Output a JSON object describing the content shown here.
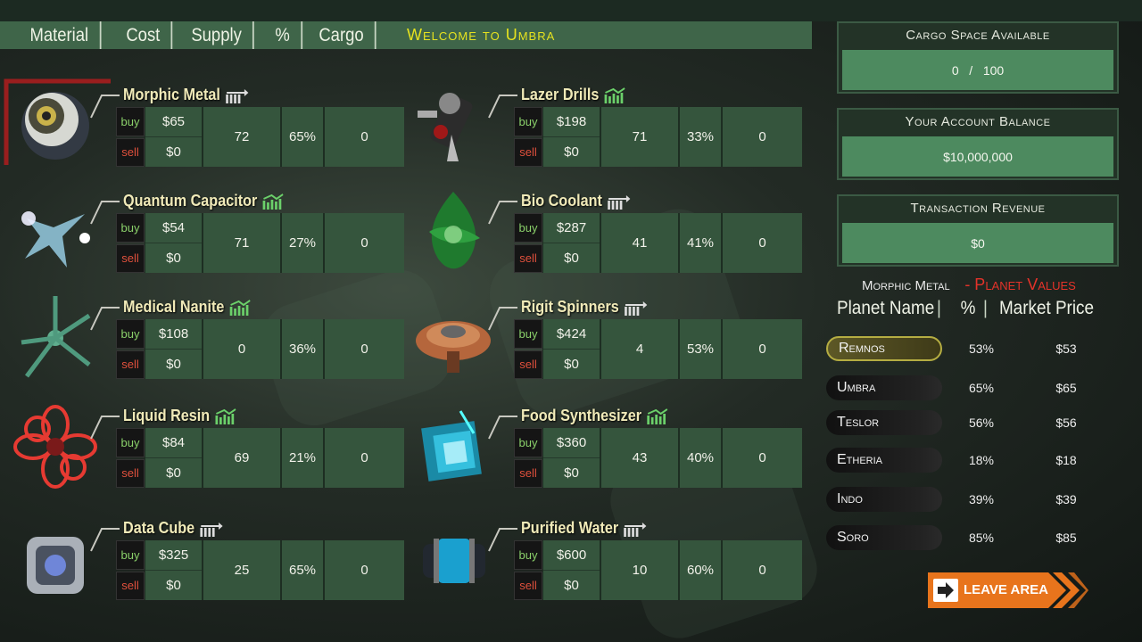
{
  "header": {
    "columns": [
      "Material",
      "Cost",
      "Supply",
      "%",
      "Cargo"
    ],
    "welcome": "Welcome to Umbra"
  },
  "buy_label": "buy",
  "sell_label": "sell",
  "items": [
    {
      "name": "Morphic Metal",
      "trend": "flat-icon",
      "buy": "$65",
      "sell": "$0",
      "supply": "72",
      "pct": "65%",
      "cargo": "0"
    },
    {
      "name": "Lazer Drills",
      "trend": "up-icon",
      "buy": "$198",
      "sell": "$0",
      "supply": "71",
      "pct": "33%",
      "cargo": "0"
    },
    {
      "name": "Quantum Capacitor",
      "trend": "up-icon",
      "buy": "$54",
      "sell": "$0",
      "supply": "71",
      "pct": "27%",
      "cargo": "0"
    },
    {
      "name": "Bio Coolant",
      "trend": "flat-icon",
      "buy": "$287",
      "sell": "$0",
      "supply": "41",
      "pct": "41%",
      "cargo": "0"
    },
    {
      "name": "Medical Nanite",
      "trend": "up-icon",
      "buy": "$108",
      "sell": "$0",
      "supply": "0",
      "pct": "36%",
      "cargo": "0"
    },
    {
      "name": "Rigit Spinners",
      "trend": "flat-icon",
      "buy": "$424",
      "sell": "$0",
      "supply": "4",
      "pct": "53%",
      "cargo": "0"
    },
    {
      "name": "Liquid Resin",
      "trend": "up-icon",
      "buy": "$84",
      "sell": "$0",
      "supply": "69",
      "pct": "21%",
      "cargo": "0"
    },
    {
      "name": "Food Synthesizer",
      "trend": "up-icon",
      "buy": "$360",
      "sell": "$0",
      "supply": "43",
      "pct": "40%",
      "cargo": "0"
    },
    {
      "name": "Data Cube",
      "trend": "flat-icon",
      "buy": "$325",
      "sell": "$0",
      "supply": "25",
      "pct": "65%",
      "cargo": "0"
    },
    {
      "name": "Purified Water",
      "trend": "flat-icon",
      "buy": "$600",
      "sell": "$0",
      "supply": "10",
      "pct": "60%",
      "cargo": "0"
    }
  ],
  "panels": {
    "cargo": {
      "title": "Cargo Space Available",
      "value": "0   /   100"
    },
    "balance": {
      "title": "Your Account Balance",
      "value": "$10,000,000"
    },
    "revenue": {
      "title": "Transaction Revenue",
      "value": "$0"
    }
  },
  "planet_values": {
    "material": "Morphic Metal",
    "label": "- Planet Values",
    "columns": [
      "Planet Name",
      "%",
      "Market Price"
    ],
    "rows": [
      {
        "name": "Remnos",
        "pct": "53%",
        "price": "$53",
        "selected": true
      },
      {
        "name": "Umbra",
        "pct": "65%",
        "price": "$65"
      },
      {
        "name": "Teslor",
        "pct": "56%",
        "price": "$56"
      },
      {
        "name": "Etheria",
        "pct": "18%",
        "price": "$18"
      },
      {
        "name": "Indo",
        "pct": "39%",
        "price": "$39"
      },
      {
        "name": "Soro",
        "pct": "85%",
        "price": "$85"
      }
    ]
  },
  "leave_button": "LEAVE AREA",
  "colors": {
    "accent_green": "#4d8a5f",
    "buy": "#8ad06a",
    "sell": "#e0503c",
    "welcome": "#e6e21f",
    "leave": "#e8741c"
  }
}
